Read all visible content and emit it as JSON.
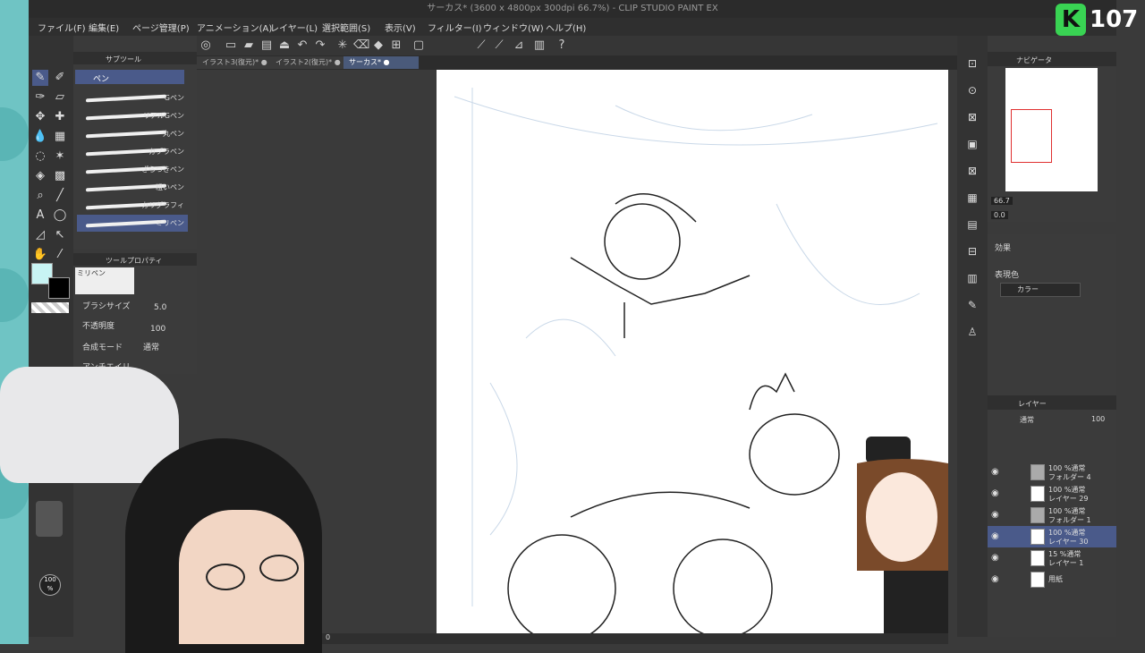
{
  "window": {
    "title": "サーカス* (3600 x 4800px 300dpi 66.7%) - CLIP STUDIO PAINT EX"
  },
  "badge": {
    "letter": "K",
    "number": "107"
  },
  "menu": [
    "ファイル(F)",
    "編集(E)",
    "ページ管理(P)",
    "アニメーション(A)",
    "レイヤー(L)",
    "選択範囲(S)",
    "表示(V)",
    "フィルター(I)",
    "ウィンドウ(W)",
    "ヘルプ(H)"
  ],
  "tabs": [
    {
      "label": "イラスト3(復元)*",
      "active": false
    },
    {
      "label": "イラスト2(復元)*",
      "active": false
    },
    {
      "label": "サーカス*",
      "active": true
    }
  ],
  "subtool": {
    "header": "サブツール",
    "group": "ペン",
    "brushes": [
      "Gペン",
      "リアルGペン",
      "丸ペン",
      "カブラペン",
      "ざらつきペン",
      "粗いペン",
      "カリグラフィ",
      "ミリペン"
    ]
  },
  "toolprop": {
    "header": "ツールプロパティ",
    "brush_name": "ミリペン",
    "size_label": "ブラシサイズ",
    "size_value": "5.0",
    "opacity_label": "不透明度",
    "opacity_value": "100",
    "blend_label": "合成モード",
    "blend_value": "通常",
    "aa_label": "アンチエイリ"
  },
  "colorwheel": {
    "opacity": "100\n%"
  },
  "navigator": {
    "header": "ナビゲータ",
    "zoom": "66.7",
    "rotation": "0.0"
  },
  "effect": {
    "header": "効果",
    "display_color_label": "表現色",
    "display_color_value": "カラー"
  },
  "layers": {
    "header": "レイヤー",
    "blend": "通常",
    "opacity": "100",
    "items": [
      {
        "mode": "100 %通常",
        "name": "フォルダー 4",
        "selected": false
      },
      {
        "mode": "100 %通常",
        "name": "レイヤー 29",
        "selected": false
      },
      {
        "mode": "100 %通常",
        "name": "フォルダー 1",
        "selected": false
      },
      {
        "mode": "100 %通常",
        "name": "レイヤー 30",
        "selected": true
      },
      {
        "mode": "15 %通常",
        "name": "レイヤー 1",
        "selected": false
      },
      {
        "mode": "",
        "name": "用紙",
        "selected": false
      }
    ]
  },
  "status": {
    "zoom": "0"
  },
  "colors": {
    "accent": "#4a5a8a",
    "frame": "#6fc4c4",
    "badge": "#39d353"
  }
}
